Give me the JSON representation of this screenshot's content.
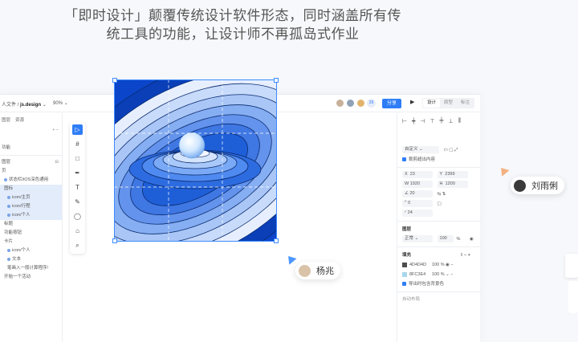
{
  "headline": {
    "line1": "「即时设计」颠覆传统设计软件形态，同时涵盖所有传",
    "line2": "统工具的功能，让设计师不再孤岛式作业"
  },
  "topbar": {
    "breadcrumb_prefix": "人文件 / ",
    "file_name": "js.design",
    "zoom": "90%",
    "collaborator_count": "29",
    "share_label": "分享",
    "play_icon": "▶",
    "modes": [
      "设计",
      "原型",
      "标注"
    ]
  },
  "left_panel": {
    "tabs": [
      "图层",
      "资源"
    ],
    "page_rows": [
      "",
      "",
      "功能"
    ],
    "section_label": "图层",
    "layers": [
      "页",
      "状态栏/iOS深色通用",
      "图标",
      "icon/主页",
      "icon/行程",
      "icon/个人",
      "标题",
      "功能按钮",
      "卡片",
      "icon/个人",
      "文本",
      "笔画入一般计算程序!",
      "开始一个活动"
    ]
  },
  "toolbar": {
    "tools": [
      "move-icon",
      "frame-icon",
      "rect-icon",
      "pen-icon",
      "text-icon",
      "pencil-icon",
      "comment-icon",
      "component-icon",
      "search-icon"
    ]
  },
  "right_panel": {
    "frame_preset": "自定义",
    "clip_label": "裁剪超出内容",
    "x": "23",
    "y": "2399",
    "w": "1920",
    "h": "1200",
    "rotation": "20",
    "radius": "0",
    "corner": "24",
    "layer_title": "图层",
    "blend_mode": "正常",
    "opacity": "100",
    "opacity_unit": "%",
    "fill_title": "填充",
    "fills": [
      {
        "hex": "4D4D4D",
        "opacity": "100",
        "color": "#4d4d4d"
      },
      {
        "hex": "8FC3E4",
        "opacity": "100",
        "color": "#8fc3e4"
      }
    ],
    "export_fill_label": "导出时包含背景色",
    "auto_layout_title": "自动布局"
  },
  "collaborators": {
    "user1": "杨兆",
    "user2": "刘雨俐"
  },
  "colors": {
    "accent": "#2f7df6",
    "selection": "#3d8bff"
  }
}
